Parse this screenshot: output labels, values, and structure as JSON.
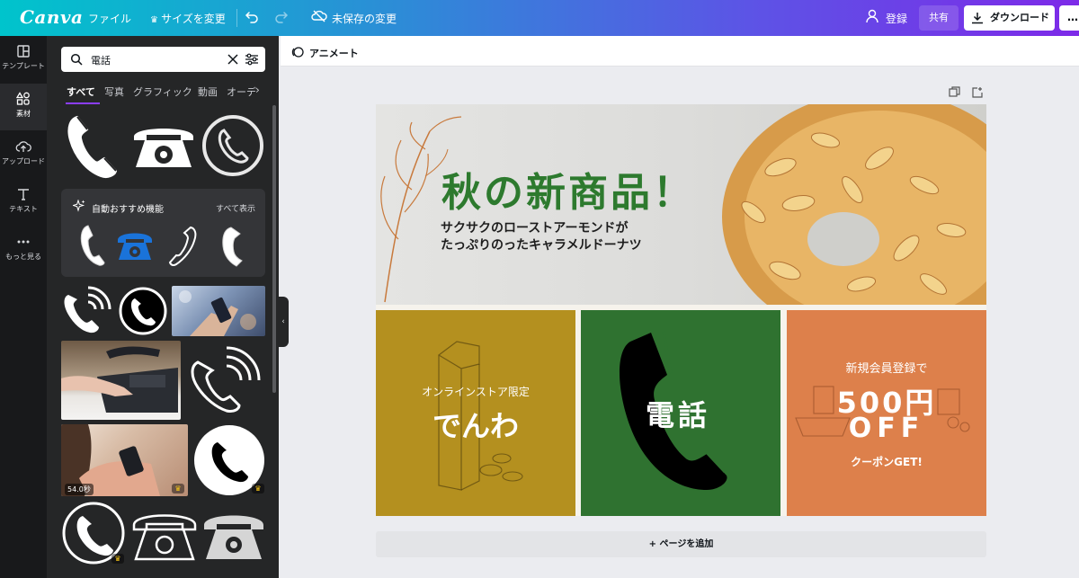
{
  "topbar": {
    "logo": "Canva",
    "file": "ファイル",
    "resize": "サイズを変更",
    "unsaved": "未保存の変更",
    "signup": "登録",
    "share": "共有",
    "download": "ダウンロード"
  },
  "rail": {
    "items": [
      {
        "label": "テンプレート",
        "icon": "template-icon"
      },
      {
        "label": "素材",
        "icon": "elements-icon"
      },
      {
        "label": "アップロード",
        "icon": "upload-icon"
      },
      {
        "label": "テキスト",
        "icon": "text-icon"
      },
      {
        "label": "もっと見る",
        "icon": "more-icon"
      }
    ]
  },
  "panel": {
    "search_value": "電話",
    "tabs": [
      "すべて",
      "写真",
      "グラフィック",
      "動画",
      "オーデ"
    ],
    "recommended_title": "自動おすすめ機能",
    "see_all": "すべて表示",
    "video_duration": "54.0秒"
  },
  "subbar": {
    "animate": "アニメート"
  },
  "design": {
    "hero_title": "秋の新商品！",
    "hero_sub_line1": "サクサクのローストアーモンドが",
    "hero_sub_line2": "たっぷりのったキャラメルドーナツ",
    "card1_small": "オンラインストア限定",
    "card1_big": "でんわ",
    "card2_text": "電話",
    "card3_small": "新規会員登録で",
    "card3_big1": "500円",
    "card3_big2": "OFF",
    "card3_small2": "クーポンGET!"
  },
  "add_page": "+ ページを追加",
  "colors": {
    "accent": "#8b3dff",
    "card_yellow": "#b4901f",
    "card_green": "#2f7230",
    "card_orange": "#dd804b",
    "title_green": "#2d7a2e"
  }
}
